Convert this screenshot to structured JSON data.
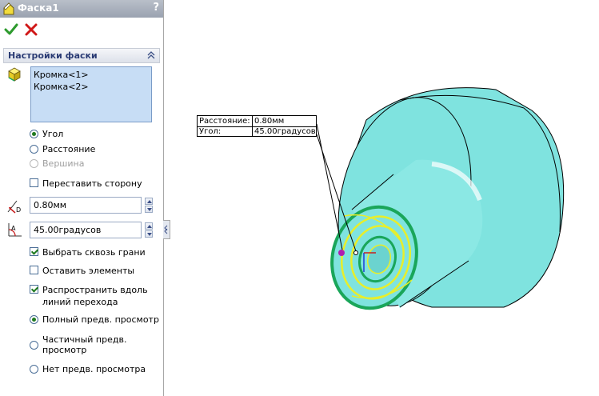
{
  "panel": {
    "title": "Фаска1",
    "help": "?",
    "section_title": "Настройки фаски",
    "edges": [
      "Кромка<1>",
      "Кромка<2>"
    ],
    "type_options": [
      {
        "label": "Угол",
        "selected": true,
        "enabled": true
      },
      {
        "label": "Расстояние",
        "selected": false,
        "enabled": true
      },
      {
        "label": "Вершина",
        "selected": false,
        "enabled": false
      }
    ],
    "flip_direction": {
      "label": "Переставить сторону",
      "checked": false
    },
    "distance": {
      "value": "0.80мм"
    },
    "angle": {
      "value": "45.00градусов"
    },
    "options": [
      {
        "label": "Выбрать сквозь грани",
        "checked": true
      },
      {
        "label": "Оставить элементы",
        "checked": false
      },
      {
        "label": "Распространить вдоль линий перехода",
        "checked": true
      }
    ],
    "preview_options": [
      {
        "label": "Полный предв. просмотр",
        "selected": true
      },
      {
        "label": "Частичный предв. просмотр",
        "selected": false
      },
      {
        "label": "Нет предв. просмотра",
        "selected": false
      }
    ]
  },
  "callout": {
    "distance_label": "Расстояние:",
    "distance_value": "0.80мм",
    "angle_label": "Угол:",
    "angle_value": "45.00градусов"
  },
  "colors": {
    "part_fill": "#7fe3df",
    "selection": "#e8ee2a",
    "edge_highlight": "#1aa65a"
  }
}
